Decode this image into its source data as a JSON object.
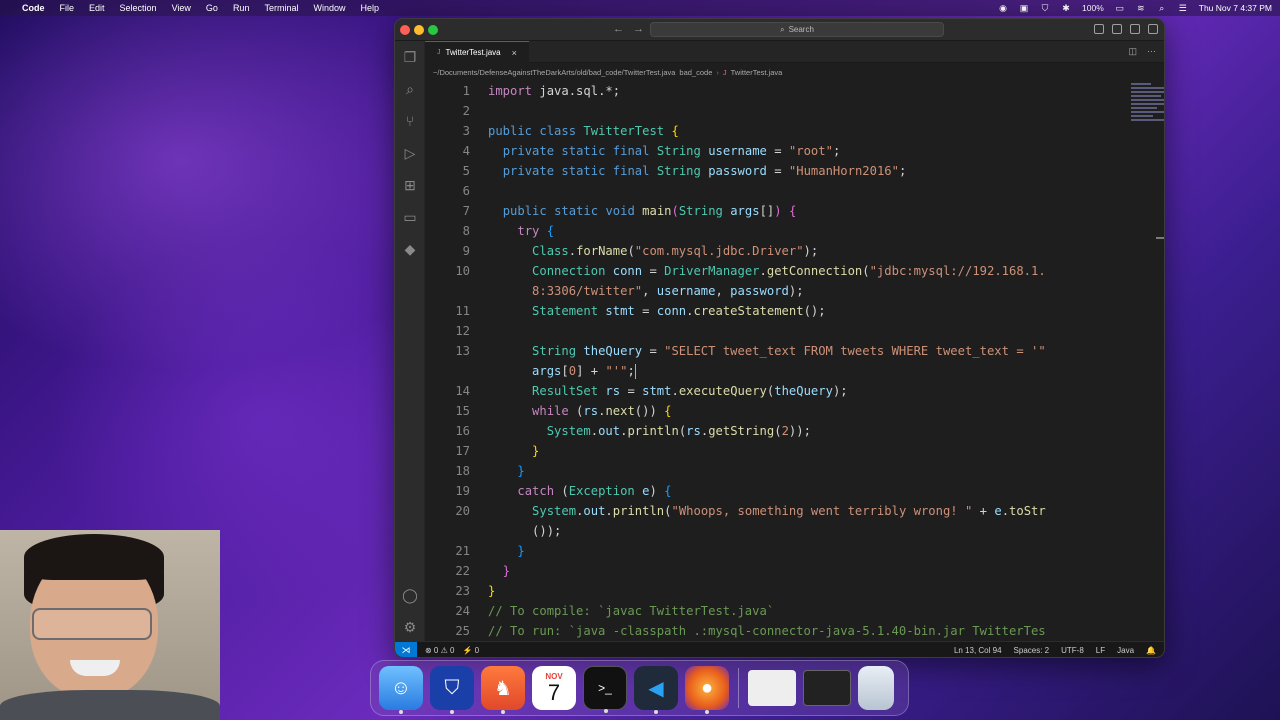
{
  "menubar": {
    "app_name": "Code",
    "items": [
      "File",
      "Edit",
      "Selection",
      "View",
      "Go",
      "Run",
      "Terminal",
      "Window",
      "Help"
    ],
    "battery": "100%",
    "datetime": "Thu Nov 7  4:37 PM"
  },
  "window": {
    "search_label": "Search"
  },
  "tab": {
    "filename": "TwitterTest.java",
    "close_glyph": "×",
    "file_icon": "J"
  },
  "breadcrumbs": {
    "path": "~/Documents/DefenseAgainstTheDarkArts/old/bad_code/TwitterTest.java",
    "folder": "bad_code",
    "file": "TwitterTest.java",
    "file_icon": "J"
  },
  "editor": {
    "line_numbers": [
      "1",
      "2",
      "3",
      "4",
      "5",
      "6",
      "7",
      "8",
      "9",
      "10",
      "",
      "11",
      "12",
      "13",
      "",
      "14",
      "15",
      "16",
      "17",
      "18",
      "19",
      "20",
      "",
      "21",
      "22",
      "23",
      "24",
      "25"
    ]
  },
  "statusbar": {
    "problems": "⊗ 0 ⚠ 0",
    "ports": "⚡ 0",
    "cursor_pos": "Ln 13, Col 94",
    "spaces": "Spaces: 2",
    "encoding": "UTF-8",
    "eol": "LF",
    "language": "Java"
  },
  "dock": {
    "calendar_month": "NOV",
    "calendar_day": "7"
  },
  "colors": {
    "accent": "#0078d4",
    "keyword": "#569cd6",
    "string": "#ce9178",
    "type": "#4ec9b0"
  }
}
